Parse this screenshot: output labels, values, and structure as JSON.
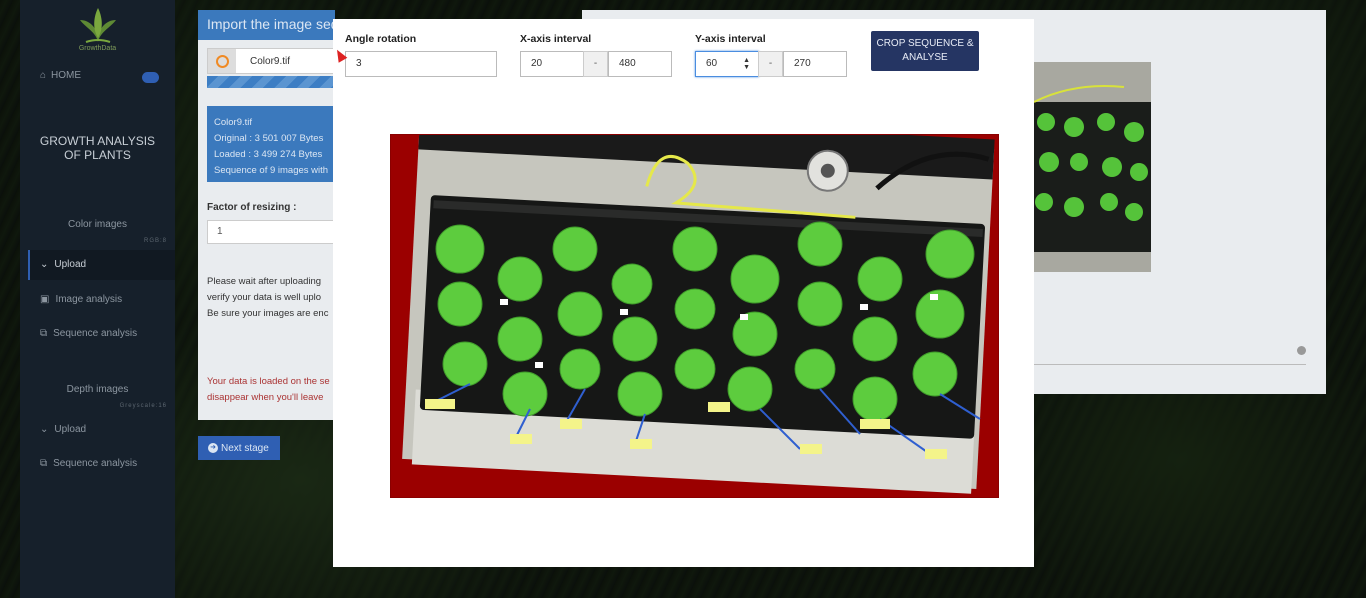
{
  "app": {
    "logo_text": "GrowthData",
    "home_label": "HOME",
    "section_title_line1": "GROWTH ANALYSIS",
    "section_title_line2": "OF PLANTS"
  },
  "sidebar": {
    "color_images": {
      "title": "Color images",
      "subtitle": "RGB:8"
    },
    "color_items": [
      {
        "label": "Upload",
        "icon": "chevron-down-icon"
      },
      {
        "label": "Image analysis",
        "icon": "image-icon"
      },
      {
        "label": "Sequence analysis",
        "icon": "images-icon"
      }
    ],
    "depth_images": {
      "title": "Depth images",
      "subtitle": "Greyscale:16"
    },
    "depth_items": [
      {
        "label": "Upload",
        "icon": "chevron-down-icon"
      },
      {
        "label": "Sequence analysis",
        "icon": "images-icon"
      }
    ]
  },
  "left_panel": {
    "header": "Import the image sequence",
    "file_name": "Color9.tif",
    "info": {
      "name": "Color9.tif",
      "original": "Original : 3 501 007 Bytes",
      "loaded": "Loaded : 3 499 274 Bytes",
      "sequence": "Sequence of 9 images with"
    },
    "resize_label": "Factor of resizing :",
    "resize_value": "1",
    "wait_text": [
      "Please wait after uploading",
      "verify your data is well uplo",
      "Be sure your images are enc"
    ],
    "warn_text": [
      "Your data is loaded on the se",
      "disappear when you'll leave"
    ],
    "next_button": "Next stage"
  },
  "modal": {
    "angle": {
      "label": "Angle rotation",
      "value": "3"
    },
    "x_interval": {
      "label": "X-axis interval",
      "min": "20",
      "dash": "-",
      "max": "480"
    },
    "y_interval": {
      "label": "Y-axis interval",
      "min": "60",
      "dash": "-",
      "max": "270"
    },
    "crop_button_line1": "CROP SEQUENCE &",
    "crop_button_line2": "ANALYSE",
    "photo_description_icon": "plant-tray-photo"
  },
  "colors": {
    "sidebar_bg": "#16202b",
    "accent_blue": "#3b79bd",
    "crop_button": "#253563",
    "crop_overlay": "#9b0000"
  }
}
